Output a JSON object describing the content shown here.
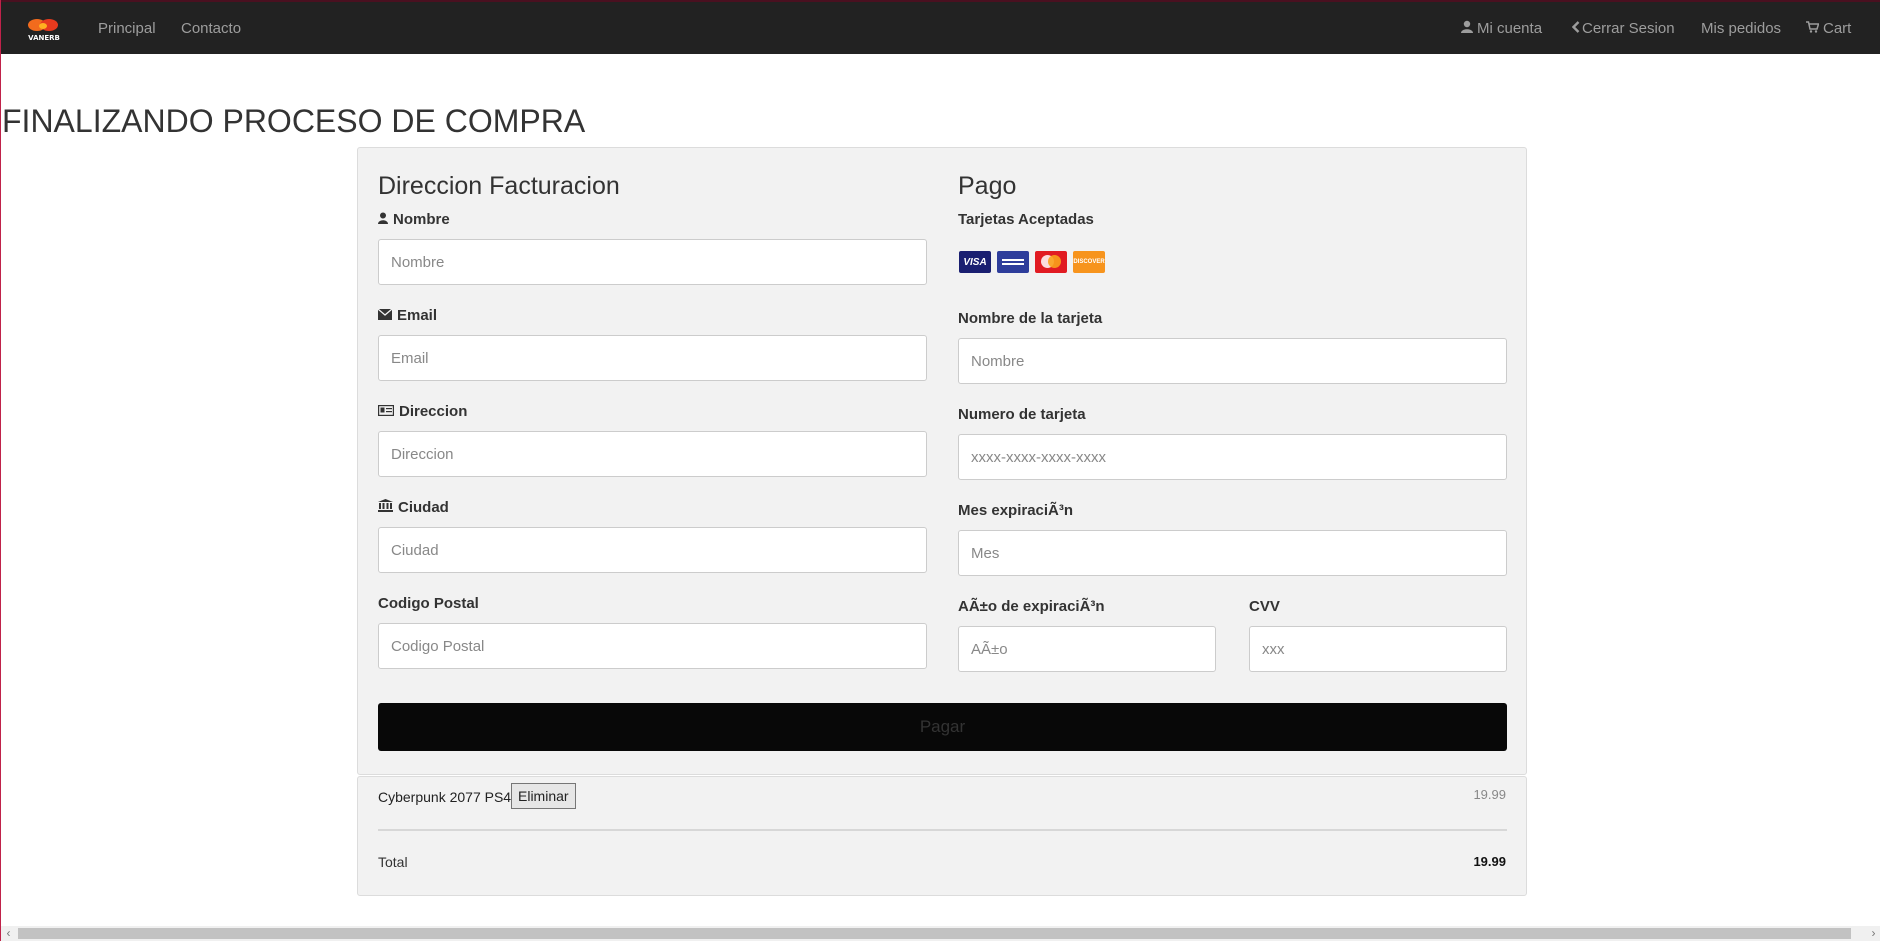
{
  "nav": {
    "logo_text": "VANERB",
    "links": [
      {
        "label": "Principal"
      },
      {
        "label": "Contacto"
      }
    ],
    "right_links": [
      {
        "label": "Mi cuenta",
        "icon": "user-icon"
      },
      {
        "label": "Cerrar Sesion",
        "icon": "chevron-left-icon"
      },
      {
        "label": "Mis pedidos"
      },
      {
        "label": "Cart",
        "icon": "cart-icon"
      }
    ]
  },
  "page": {
    "title": "FINALIZANDO PROCESO DE COMPRA"
  },
  "billing": {
    "title": "Direccion Facturacion",
    "fields": [
      {
        "label": "Nombre",
        "placeholder": "Nombre",
        "icon": "user-icon"
      },
      {
        "label": "Email",
        "placeholder": "Email",
        "icon": "envelope-icon"
      },
      {
        "label": "Direccion",
        "placeholder": "Direccion",
        "icon": "id-card-icon"
      },
      {
        "label": "Ciudad",
        "placeholder": "Ciudad",
        "icon": "institution-icon"
      },
      {
        "label": "Codigo Postal",
        "placeholder": "Codigo Postal"
      }
    ]
  },
  "payment": {
    "title": "Pago",
    "accepted_label": "Tarjetas Aceptadas",
    "cards": [
      "VISA",
      "AMERICAN EXPRESS",
      "MasterCard",
      "DISCOVER"
    ],
    "card_name": {
      "label": "Nombre de la tarjeta",
      "placeholder": "Nombre"
    },
    "card_number": {
      "label": "Numero de tarjeta",
      "placeholder": "xxxx-xxxx-xxxx-xxxx"
    },
    "exp_month": {
      "label": "Mes expiraciÃ³n",
      "placeholder": "Mes"
    },
    "exp_year": {
      "label": "AÃ±o de expiraciÃ³n",
      "placeholder": "AÃ±o"
    },
    "cvv": {
      "label": "CVV",
      "placeholder": "xxx"
    }
  },
  "pay_button": "Pagar",
  "cart": {
    "items": [
      {
        "name": "Cyberpunk 2077 PS4",
        "remove_label": "Eliminar",
        "price": "19.99"
      }
    ],
    "total_label": "Total",
    "total_value": "19.99"
  },
  "colors": {
    "navbar_bg": "#222222",
    "panel_bg": "#f2f2f2",
    "pay_button_bg": "#080808",
    "nav_text": "#9d9d9d"
  }
}
